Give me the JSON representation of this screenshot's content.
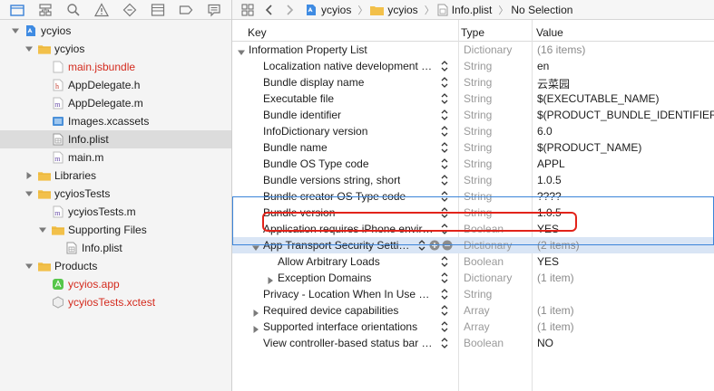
{
  "navigator": {
    "tree": [
      {
        "label": "ycyios",
        "icon": "project-icon",
        "indent": 0,
        "disclosure": "open",
        "red": false,
        "selected": false
      },
      {
        "label": "ycyios",
        "icon": "folder-icon",
        "indent": 1,
        "disclosure": "open",
        "red": false,
        "selected": false
      },
      {
        "label": "main.jsbundle",
        "icon": "blank-file-icon",
        "indent": 2,
        "disclosure": "none",
        "red": true,
        "selected": false
      },
      {
        "label": "AppDelegate.h",
        "icon": "header-file-icon",
        "indent": 2,
        "disclosure": "none",
        "red": false,
        "selected": false
      },
      {
        "label": "AppDelegate.m",
        "icon": "source-file-icon",
        "indent": 2,
        "disclosure": "none",
        "red": false,
        "selected": false
      },
      {
        "label": "Images.xcassets",
        "icon": "asset-catalog-icon",
        "indent": 2,
        "disclosure": "none",
        "red": false,
        "selected": false
      },
      {
        "label": "Info.plist",
        "icon": "plist-file-icon",
        "indent": 2,
        "disclosure": "none",
        "red": false,
        "selected": true
      },
      {
        "label": "main.m",
        "icon": "source-file-icon",
        "indent": 2,
        "disclosure": "none",
        "red": false,
        "selected": false
      },
      {
        "label": "Libraries",
        "icon": "folder-icon",
        "indent": 1,
        "disclosure": "closed",
        "red": false,
        "selected": false
      },
      {
        "label": "ycyiosTests",
        "icon": "folder-icon",
        "indent": 1,
        "disclosure": "open",
        "red": false,
        "selected": false
      },
      {
        "label": "ycyiosTests.m",
        "icon": "source-file-icon",
        "indent": 2,
        "disclosure": "none",
        "red": false,
        "selected": false
      },
      {
        "label": "Supporting Files",
        "icon": "folder-icon",
        "indent": 2,
        "disclosure": "open",
        "red": false,
        "selected": false
      },
      {
        "label": "Info.plist",
        "icon": "plist-file-icon",
        "indent": 3,
        "disclosure": "none",
        "red": false,
        "selected": false
      },
      {
        "label": "Products",
        "icon": "folder-icon",
        "indent": 1,
        "disclosure": "open",
        "red": false,
        "selected": false
      },
      {
        "label": "ycyios.app",
        "icon": "app-icon",
        "indent": 2,
        "disclosure": "none",
        "red": true,
        "selected": false
      },
      {
        "label": "ycyiosTests.xctest",
        "icon": "xctest-bundle-icon",
        "indent": 2,
        "disclosure": "none",
        "red": true,
        "selected": false
      }
    ]
  },
  "jumpbar": {
    "crumbs": [
      "ycyios",
      "ycyios",
      "Info.plist",
      "No Selection"
    ]
  },
  "plist": {
    "headers": {
      "key": "Key",
      "type": "Type",
      "value": "Value"
    },
    "rows": [
      {
        "key": "Information Property List",
        "type": "Dictionary",
        "value": "(16 items)",
        "level": 0,
        "disclosure": "open",
        "stepper": false,
        "value_grey": true
      },
      {
        "key": "Localization native development re...",
        "type": "String",
        "value": "en",
        "level": 1,
        "disclosure": "none",
        "stepper": true,
        "value_grey": false
      },
      {
        "key": "Bundle display name",
        "type": "String",
        "value": "云菜园",
        "level": 1,
        "disclosure": "none",
        "stepper": true,
        "value_grey": false
      },
      {
        "key": "Executable file",
        "type": "String",
        "value": "$(EXECUTABLE_NAME)",
        "level": 1,
        "disclosure": "none",
        "stepper": true,
        "value_grey": false
      },
      {
        "key": "Bundle identifier",
        "type": "String",
        "value": "$(PRODUCT_BUNDLE_IDENTIFIER)",
        "level": 1,
        "disclosure": "none",
        "stepper": true,
        "value_grey": false
      },
      {
        "key": "InfoDictionary version",
        "type": "String",
        "value": "6.0",
        "level": 1,
        "disclosure": "none",
        "stepper": true,
        "value_grey": false
      },
      {
        "key": "Bundle name",
        "type": "String",
        "value": "$(PRODUCT_NAME)",
        "level": 1,
        "disclosure": "none",
        "stepper": true,
        "value_grey": false
      },
      {
        "key": "Bundle OS Type code",
        "type": "String",
        "value": "APPL",
        "level": 1,
        "disclosure": "none",
        "stepper": true,
        "value_grey": false
      },
      {
        "key": "Bundle versions string, short",
        "type": "String",
        "value": "1.0.5",
        "level": 1,
        "disclosure": "none",
        "stepper": true,
        "value_grey": false
      },
      {
        "key": "Bundle creator OS Type code",
        "type": "String",
        "value": "????",
        "level": 1,
        "disclosure": "none",
        "stepper": true,
        "value_grey": false
      },
      {
        "key": "Bundle version",
        "type": "String",
        "value": "1.0.5",
        "level": 1,
        "disclosure": "none",
        "stepper": true,
        "value_grey": false
      },
      {
        "key": "Application requires iPhone enviro...",
        "type": "Boolean",
        "value": "YES",
        "level": 1,
        "disclosure": "none",
        "stepper": true,
        "value_grey": false
      },
      {
        "key": "App Transport Security Settin...",
        "type": "Dictionary",
        "value": "(2 items)",
        "level": 1,
        "disclosure": "open",
        "stepper": true,
        "value_grey": true,
        "selected": true,
        "plusminus": true
      },
      {
        "key": "Allow Arbitrary Loads",
        "type": "Boolean",
        "value": "YES",
        "level": 2,
        "disclosure": "none",
        "stepper": true,
        "value_grey": false
      },
      {
        "key": "Exception Domains",
        "type": "Dictionary",
        "value": "(1 item)",
        "level": 2,
        "disclosure": "closed",
        "stepper": true,
        "value_grey": true
      },
      {
        "key": "Privacy - Location When In Use Us...",
        "type": "String",
        "value": "",
        "level": 1,
        "disclosure": "none",
        "stepper": true,
        "value_grey": false
      },
      {
        "key": "Required device capabilities",
        "type": "Array",
        "value": "(1 item)",
        "level": 1,
        "disclosure": "closed",
        "stepper": true,
        "value_grey": true
      },
      {
        "key": "Supported interface orientations",
        "type": "Array",
        "value": "(1 item)",
        "level": 1,
        "disclosure": "closed",
        "stepper": true,
        "value_grey": true
      },
      {
        "key": "View controller-based status bar a...",
        "type": "Boolean",
        "value": "NO",
        "level": 1,
        "disclosure": "none",
        "stepper": true,
        "value_grey": false
      }
    ]
  },
  "colors": {
    "selection_blue": "#3b84d9",
    "highlight_red": "#e2231a",
    "missing_file_red": "#d42b1e",
    "folder_yellow": "#f2c04a"
  }
}
